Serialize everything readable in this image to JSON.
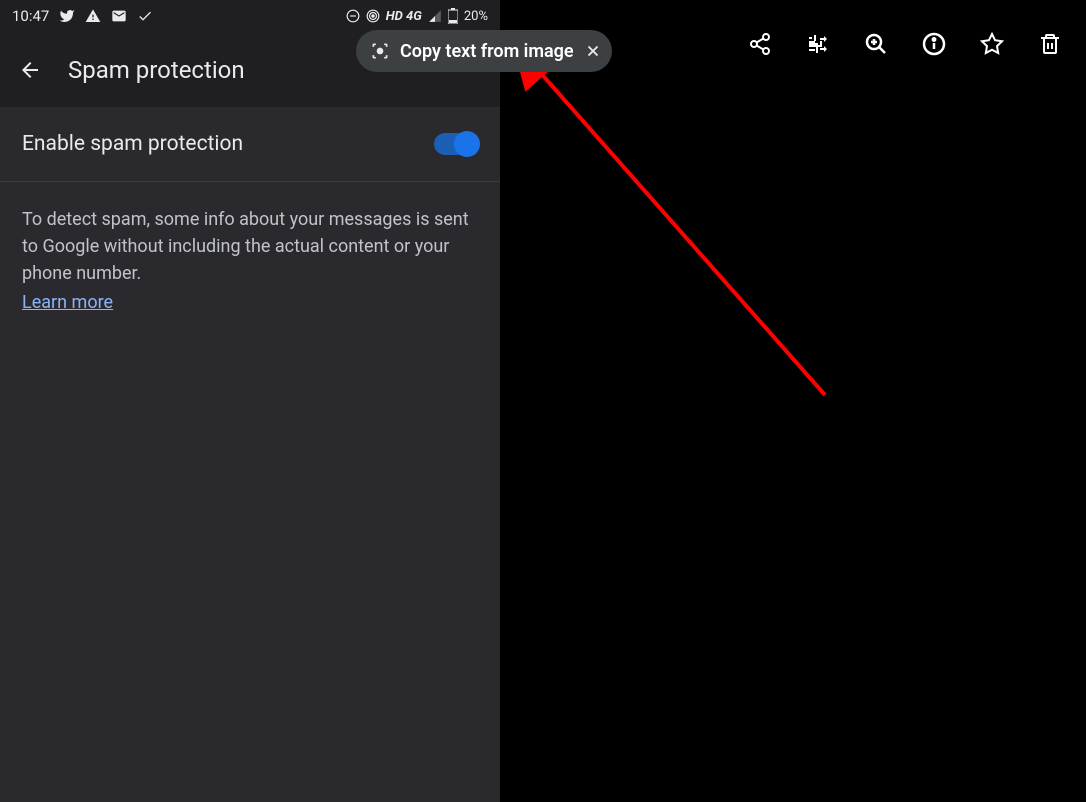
{
  "status_bar": {
    "time": "10:47",
    "network_label": "HD 4G",
    "battery": "20%"
  },
  "header": {
    "title": "Spam protection"
  },
  "toggle": {
    "label": "Enable spam protection",
    "enabled": true
  },
  "description": {
    "text": "To detect spam, some info about your messages is sent to Google without including the actual content or your phone number.",
    "learn_more": "Learn more"
  },
  "chip": {
    "label": "Copy text from image"
  }
}
